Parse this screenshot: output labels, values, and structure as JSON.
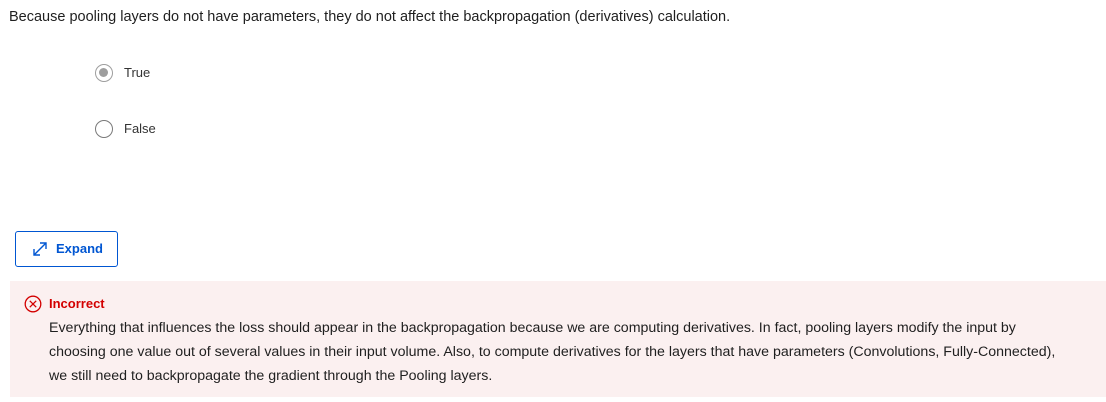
{
  "question": {
    "text": "Because pooling layers do not have parameters, they do not affect the backpropagation (derivatives) calculation."
  },
  "options": [
    {
      "label": "True",
      "selected": true
    },
    {
      "label": "False",
      "selected": false
    }
  ],
  "expand_button": {
    "label": "Expand",
    "icon": "expand-arrows-icon"
  },
  "feedback": {
    "status": "Incorrect",
    "icon": "error-circle-x-icon",
    "lines": [
      "Everything that influences the loss should appear in the backpropagation because we are computing derivatives. In fact, pooling layers modify the input by",
      "choosing one value out of several values in their input volume. Also, to compute derivatives for the layers that have parameters (Convolutions, Fully-Connected),",
      "we still need to backpropagate the gradient through the Pooling layers."
    ]
  },
  "colors": {
    "accent": "#0056d2",
    "error": "#d30000",
    "feedback_background": "#fbf0f0",
    "radio_selected": "#9e9e9e"
  }
}
